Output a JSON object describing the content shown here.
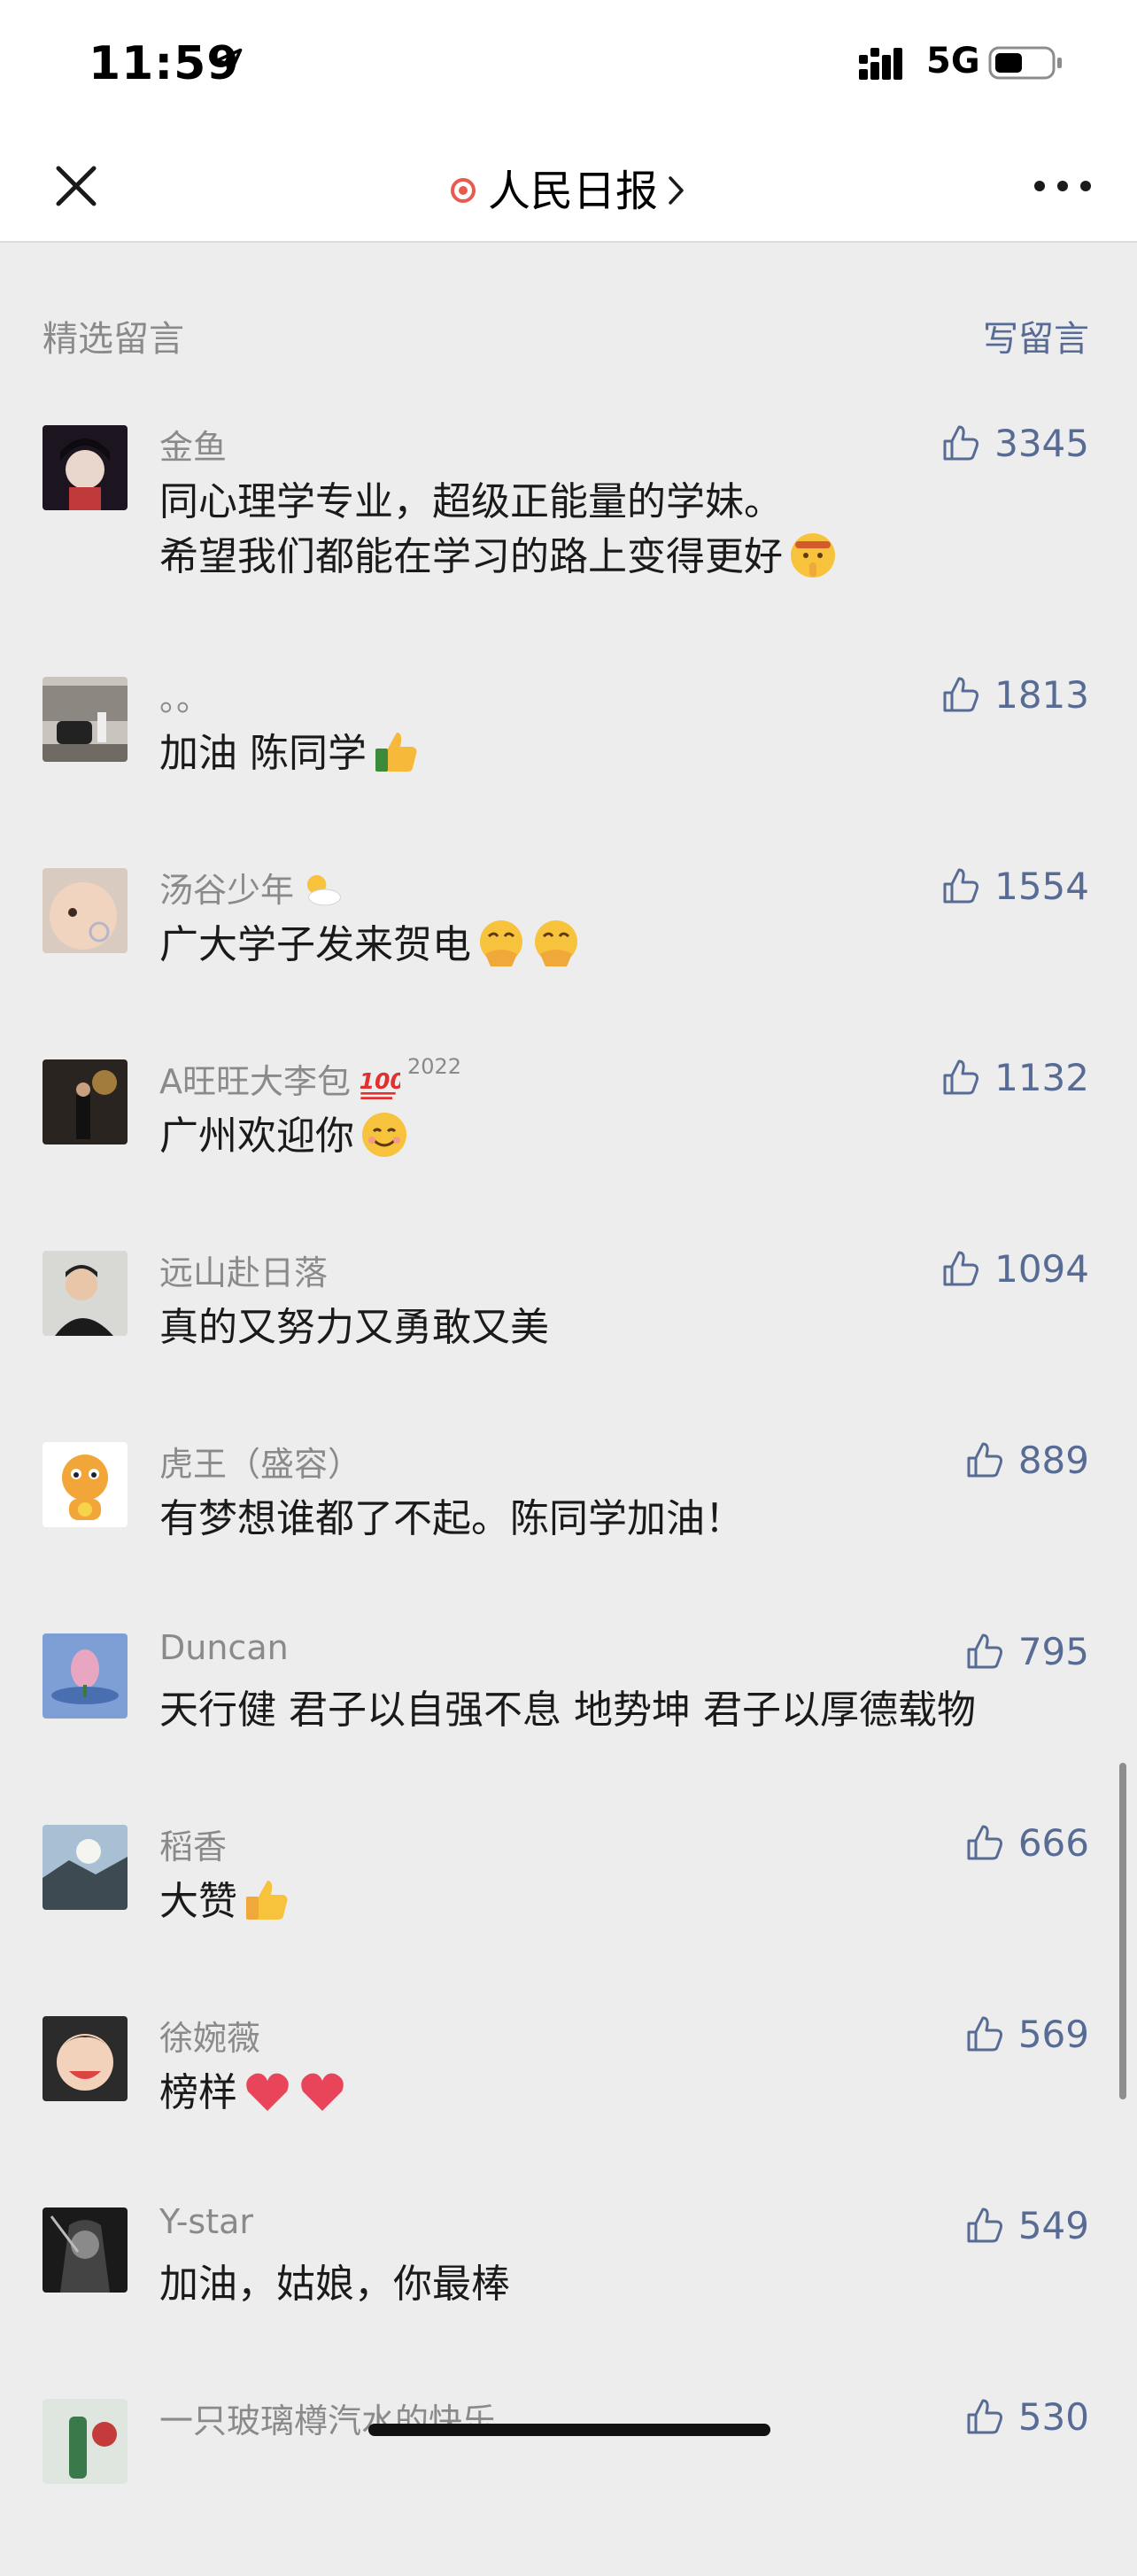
{
  "status_bar": {
    "time": "11:59",
    "network": "5G",
    "icons": [
      "location-arrow-icon",
      "signal-icon",
      "battery-icon"
    ]
  },
  "nav": {
    "title": "人民日报",
    "icons": [
      "close-icon",
      "live-dot-icon",
      "chevron-right-icon",
      "more-icon"
    ]
  },
  "section": {
    "title": "精选留言",
    "write": "写留言"
  },
  "comments": [
    {
      "nick": "金鱼",
      "lines": [
        "同心理学专业，超级正能量的学妹。",
        "希望我们都能在学习的路上变得更好"
      ],
      "likes": "3345",
      "emoji": "shushing-face-emoji"
    },
    {
      "nick": "。。",
      "lines": [
        "加油 陈同学"
      ],
      "likes": "1813",
      "emoji": "thumbs-up-emoji"
    },
    {
      "nick": "汤谷少年",
      "lines": [
        "广大学子发来贺电"
      ],
      "likes": "1554",
      "emoji": "hand-over-mouth-emoji"
    },
    {
      "nick": "A旺旺大李包",
      "badge": "2022",
      "lines": [
        "广州欢迎你"
      ],
      "likes": "1132",
      "emoji": "smiling-face-emoji"
    },
    {
      "nick": "远山赴日落",
      "lines": [
        "真的又努力又勇敢又美"
      ],
      "likes": "1094"
    },
    {
      "nick": "虎王（盛容）",
      "lines": [
        "有梦想谁都了不起。陈同学加油！"
      ],
      "likes": "889"
    },
    {
      "nick": "Duncan",
      "lines": [
        "天行健 君子以自强不息 地势坤 君子以厚德载物"
      ],
      "likes": "795"
    },
    {
      "nick": "稻香",
      "lines": [
        "大赞"
      ],
      "likes": "666",
      "emoji": "thumbs-up-emoji"
    },
    {
      "nick": "徐婉薇",
      "lines": [
        "榜样"
      ],
      "likes": "569",
      "emoji": "red-heart-emoji"
    },
    {
      "nick": "Y-star",
      "lines": [
        "加油，姑娘，你最棒"
      ],
      "likes": "549"
    },
    {
      "nick": "一只玻璃樽汽水的快乐",
      "lines": [
        ""
      ],
      "likes": "530"
    }
  ],
  "colors": {
    "link": "#576b95",
    "live": "#e85b4f",
    "background": "#ededed"
  }
}
